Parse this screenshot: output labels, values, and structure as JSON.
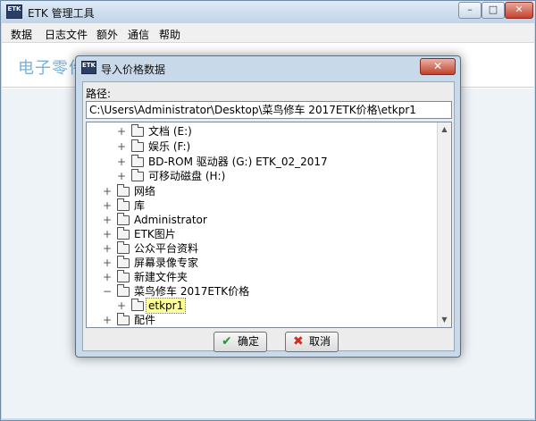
{
  "main_window": {
    "icon_text": "ETK",
    "title": "ETK 管理工具",
    "controls": {
      "minimize": "–",
      "maximize": "□",
      "close": "✕"
    }
  },
  "menu": [
    "数据",
    "日志文件",
    "额外",
    "通信",
    "帮助"
  ],
  "content": {
    "title": "电子零件目录 - 管理工具"
  },
  "dialog": {
    "icon_text": "ETK",
    "title": "导入价格数据",
    "close": "✕",
    "path_label": "路径:",
    "path_value": "C:\\Users\\Administrator\\Desktop\\菜鸟修车 2017ETK价格\\etkpr1",
    "tree": [
      {
        "label": "文档 (E:)",
        "expander": "+"
      },
      {
        "label": "娱乐 (F:)",
        "expander": "+"
      },
      {
        "label": "BD-ROM 驱动器 (G:) ETK_02_2017",
        "expander": "+"
      },
      {
        "label": "可移动磁盘 (H:)",
        "expander": "+"
      },
      {
        "label": "网络",
        "expander": "+"
      },
      {
        "label": "库",
        "expander": "+"
      },
      {
        "label": "Administrator",
        "expander": "+"
      },
      {
        "label": "ETK图片",
        "expander": "+"
      },
      {
        "label": "公众平台资料",
        "expander": "+"
      },
      {
        "label": "屏幕录像专家",
        "expander": "+"
      },
      {
        "label": "新建文件夹",
        "expander": "+"
      },
      {
        "label": "菜鸟修车 2017ETK价格",
        "expander": "−"
      },
      {
        "label": "etkpr1",
        "expander": "+",
        "selected": true
      },
      {
        "label": "配件",
        "expander": "+"
      }
    ],
    "scroll": {
      "up": "▲",
      "down": "▼"
    },
    "buttons": {
      "ok": {
        "icon": "✔",
        "label": "确定"
      },
      "cancel": {
        "icon": "✖",
        "label": "取消"
      }
    }
  },
  "colors": {
    "accent_title": "#7ab0d8",
    "selection": "#ffff9c",
    "ok_icon": "#1e9a2e",
    "cancel_icon": "#d22c1c"
  }
}
